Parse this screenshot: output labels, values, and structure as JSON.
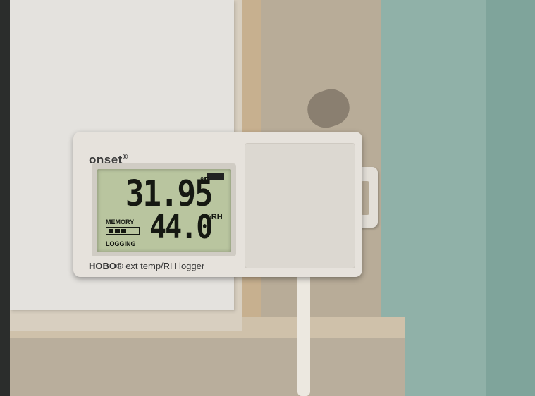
{
  "device": {
    "brand": "onset",
    "brand_mark": "®",
    "model_prefix": "HOBO",
    "model_mark": "®",
    "model_desc": " ext temp/RH logger"
  },
  "display": {
    "temperature": "31.95",
    "temperature_unit": "°F",
    "humidity": "44.0",
    "humidity_unit": "%RH",
    "memory_label": "MEMORY",
    "logging_label": "LOGGING"
  },
  "colors": {
    "lcd_background": "#b9c59f",
    "housing": "#e6e2dc",
    "teal_wood": "#7fa49b"
  }
}
